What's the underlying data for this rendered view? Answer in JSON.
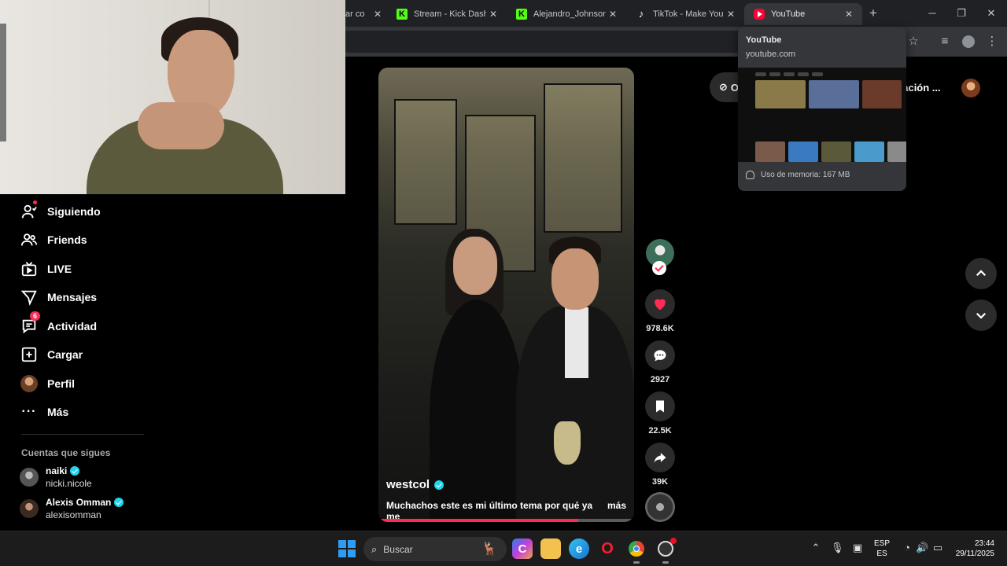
{
  "browser": {
    "tabs": [
      {
        "label": "ar co",
        "active": false
      },
      {
        "label": "Stream - Kick Dashb",
        "favicon": "K",
        "active": false
      },
      {
        "label": "Alejandro_Johnson S",
        "favicon": "K",
        "active": false
      },
      {
        "label": "TikTok - Make Your D",
        "favicon": "♪",
        "active": false
      },
      {
        "label": "YouTube",
        "active": true
      }
    ],
    "new_tab": "+",
    "window_controls": {
      "minimize": "─",
      "restore": "❐",
      "close": "✕"
    },
    "tab_close": "✕",
    "hover_card": {
      "title": "YouTube",
      "domain": "youtube.com",
      "memory": "Uso de memoria: 167 MB"
    }
  },
  "tiktok": {
    "nav": [
      {
        "label": "Siguiendo",
        "icon": "following-icon"
      },
      {
        "label": "Friends",
        "icon": "friends-icon"
      },
      {
        "label": "LIVE",
        "icon": "live-icon"
      },
      {
        "label": "Mensajes",
        "icon": "messages-icon"
      },
      {
        "label": "Actividad",
        "icon": "activity-icon",
        "badge": "6"
      },
      {
        "label": "Cargar",
        "icon": "upload-icon"
      },
      {
        "label": "Perfil",
        "icon": "profile-avatar"
      },
      {
        "label": "Más",
        "icon": "more-icon"
      }
    ],
    "following_section_title": "Cuentas que sigues",
    "following": [
      {
        "name": "naiki",
        "handle": "nicki.nicole",
        "verified": true
      },
      {
        "name": "Alexis Omman",
        "handle": "alexisomman",
        "verified": true
      }
    ],
    "top_controls": {
      "get_app_label": "O",
      "pc_app_label": "cación ..."
    },
    "video": {
      "username": "westcol",
      "verified": true,
      "description": "Muchachos este es mi último tema por qué ya me",
      "more_label": "más",
      "progress": 0.78
    },
    "actions": {
      "likes": "978.6K",
      "comments": "2927",
      "saves": "22.5K",
      "shares": "39K"
    }
  },
  "taskbar": {
    "search_placeholder": "Buscar",
    "language_line1": "ESP",
    "language_line2": "ES",
    "time": "23:44",
    "date": "29/11/2025"
  },
  "colors": {
    "accent": "#fe2c55",
    "verified": "#20d5ec",
    "kick_green": "#53fc18",
    "youtube_red": "#ff0033"
  }
}
